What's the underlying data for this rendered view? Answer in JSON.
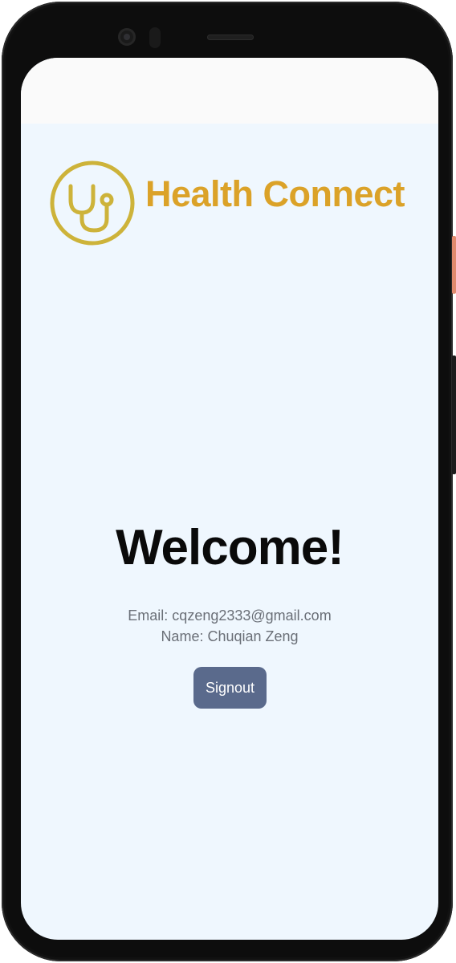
{
  "app": {
    "brand_title": "Health Connect",
    "logo_icon": "stethoscope-icon",
    "brand_color": "#dba228"
  },
  "main": {
    "heading": "Welcome!",
    "email_line": "Email: cqzeng2333@gmail.com",
    "name_line": "Name: Chuqian Zeng",
    "signout_label": "Signout",
    "button_color": "#5a6a8c",
    "background_color": "#eff7fe"
  }
}
